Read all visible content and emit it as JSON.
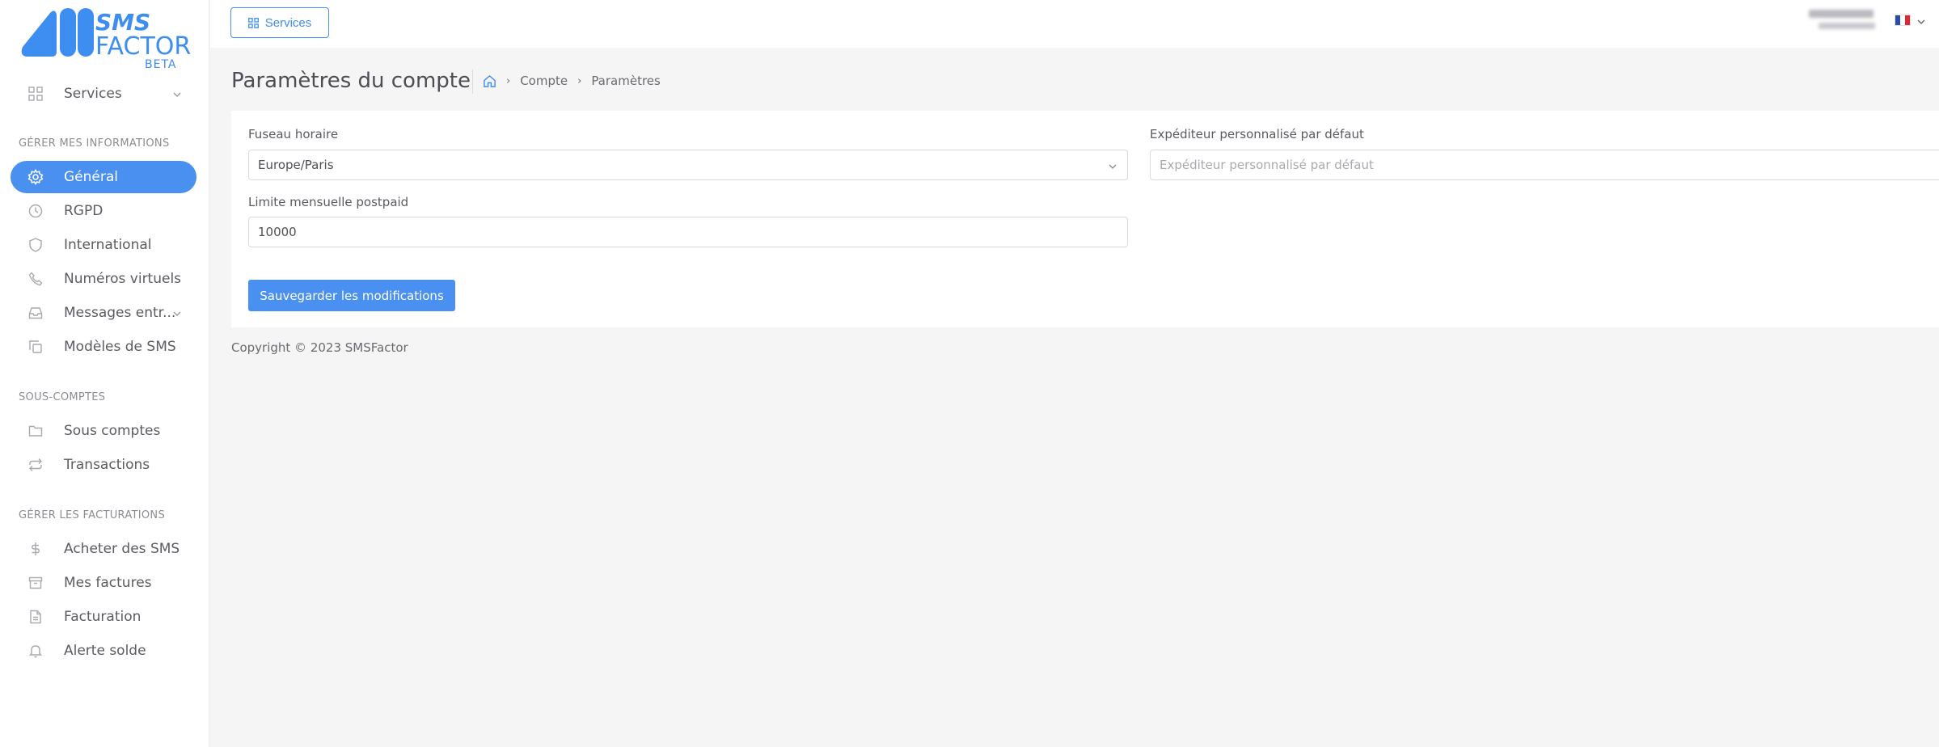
{
  "logo": {
    "line1": "SMS",
    "line2": "FACTOR",
    "badge": "BETA",
    "brand_color": "#3d8ef0"
  },
  "sidebar": {
    "services": {
      "label": "Services",
      "icon": "grid-icon"
    },
    "sections": [
      {
        "title": "GÉRER MES INFORMATIONS"
      },
      {
        "title": "SOUS-COMPTES"
      },
      {
        "title": "GÉRER LES FACTURATIONS"
      }
    ],
    "items": [
      {
        "label": "Général",
        "icon": "gear-icon",
        "active": true
      },
      {
        "label": "RGPD",
        "icon": "clock-icon"
      },
      {
        "label": "International",
        "icon": "shield-icon"
      },
      {
        "label": "Numéros virtuels",
        "icon": "phone-icon"
      },
      {
        "label": "Messages entr...",
        "icon": "inbox-icon"
      },
      {
        "label": "Modèles de SMS",
        "icon": "copy-icon"
      },
      {
        "label": "Sous comptes",
        "icon": "folder-icon"
      },
      {
        "label": "Transactions",
        "icon": "repeat-icon"
      },
      {
        "label": "Acheter des SMS",
        "icon": "dollar-icon"
      },
      {
        "label": "Mes factures",
        "icon": "archive-icon"
      },
      {
        "label": "Facturation",
        "icon": "file-icon"
      },
      {
        "label": "Alerte solde",
        "icon": "bell-icon"
      }
    ],
    "accent_color": "#4a90f0"
  },
  "topbar": {
    "services_label": "Services",
    "language_flag": "FR"
  },
  "page": {
    "title": "Paramètres du compte",
    "breadcrumb": [
      "Compte",
      "Paramètres"
    ]
  },
  "form": {
    "timezone_label": "Fuseau horaire",
    "timezone_value": "Europe/Paris",
    "sender_label": "Expéditeur personnalisé par défaut",
    "sender_placeholder": "Expéditeur personnalisé par défaut",
    "limit_label": "Limite mensuelle postpaid",
    "limit_value": "10000",
    "save_label": "Sauvegarder les modifications"
  },
  "footer": {
    "copyright": "Copyright © 2023 SMSFactor"
  }
}
